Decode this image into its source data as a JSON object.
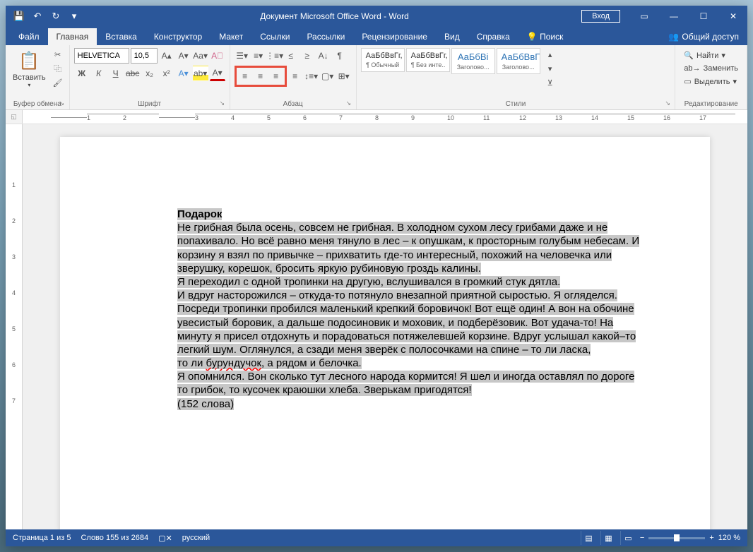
{
  "titlebar": {
    "title": "Документ Microsoft Office Word  -  Word",
    "login": "Вход"
  },
  "tabs": {
    "file": "Файл",
    "home": "Главная",
    "insert": "Вставка",
    "design": "Конструктор",
    "layout": "Макет",
    "references": "Ссылки",
    "mailings": "Рассылки",
    "review": "Рецензирование",
    "view": "Вид",
    "help": "Справка",
    "search": "Поиск",
    "share": "Общий доступ"
  },
  "ribbon": {
    "clipboard": {
      "label": "Буфер обмена",
      "paste": "Вставить"
    },
    "font": {
      "label": "Шрифт",
      "name": "HELVETICA",
      "size": "10,5",
      "bold": "Ж",
      "italic": "К",
      "underline": "Ч"
    },
    "paragraph": {
      "label": "Абзац"
    },
    "styles": {
      "label": "Стили",
      "items": [
        {
          "preview": "АаБбВвГг,",
          "name": "¶ Обычный"
        },
        {
          "preview": "АаБбВвГг,",
          "name": "¶ Без инте..."
        },
        {
          "preview": "АаБбВі",
          "name": "Заголово..."
        },
        {
          "preview": "АаБбВвГ",
          "name": "Заголово..."
        }
      ]
    },
    "editing": {
      "label": "Редактирование",
      "find": "Найти",
      "replace": "Заменить",
      "select": "Выделить"
    }
  },
  "ruler": {
    "h": [
      "",
      "1",
      "2",
      "",
      "3",
      "4",
      "5",
      "6",
      "7",
      "8",
      "9",
      "10",
      "11",
      "12",
      "13",
      "14",
      "15",
      "16",
      "17"
    ]
  },
  "document": {
    "title": "Подарок",
    "p1a": "Не грибная была осень, совсем не грибная. В холодном сухом лесу грибами даже и не",
    "p1b": "попахивало. Но всё равно меня тянуло в лес – к опушкам, к просторным голубым небесам. И",
    "p1c": "корзину я взял по привычке – прихватить где-то интересный, похожий на человечка или",
    "p1d": "зверушку, корешок, бросить яркую рубиновую гроздь калины.",
    "p2": "Я переходил с одной тропинки на другую, вслушивался в громкий стук дятла.",
    "p3a": "И вдруг насторожился – откуда-то потянуло внезапной приятной сыростью. Я огляделся.",
    "p3b": "Посреди тропинки пробился маленький крепкий боровичок! Вот ещё один! А вон на обочине",
    "p3c": "увесистый боровик, а дальше подосиновик и моховик, и подберёзовик. Вот удача-то! На",
    "p3d": "минуту я присел отдохнуть и порадоваться потяжелевшей корзине. Вдруг услышал какой–то",
    "p3e": "легкий шум. Оглянулся, а сзади меня зверёк с полосочками на спине – то ли ласка,",
    "p3f_a": "то ли ",
    "p3f_b": "бурундучок",
    "p3f_c": ", а рядом и белочка.",
    "p4a": "Я опомнился. Вон сколько тут лесного народа кормится! Я шел и иногда оставлял по дороге",
    "p4b": "то грибок, то кусочек краюшки хлеба. Зверькам пригодятся!",
    "p5": "(152 слова)"
  },
  "statusbar": {
    "page": "Страница 1 из 5",
    "words": "Слово 155 из 2684",
    "lang": "русский",
    "zoom": "120 %"
  }
}
